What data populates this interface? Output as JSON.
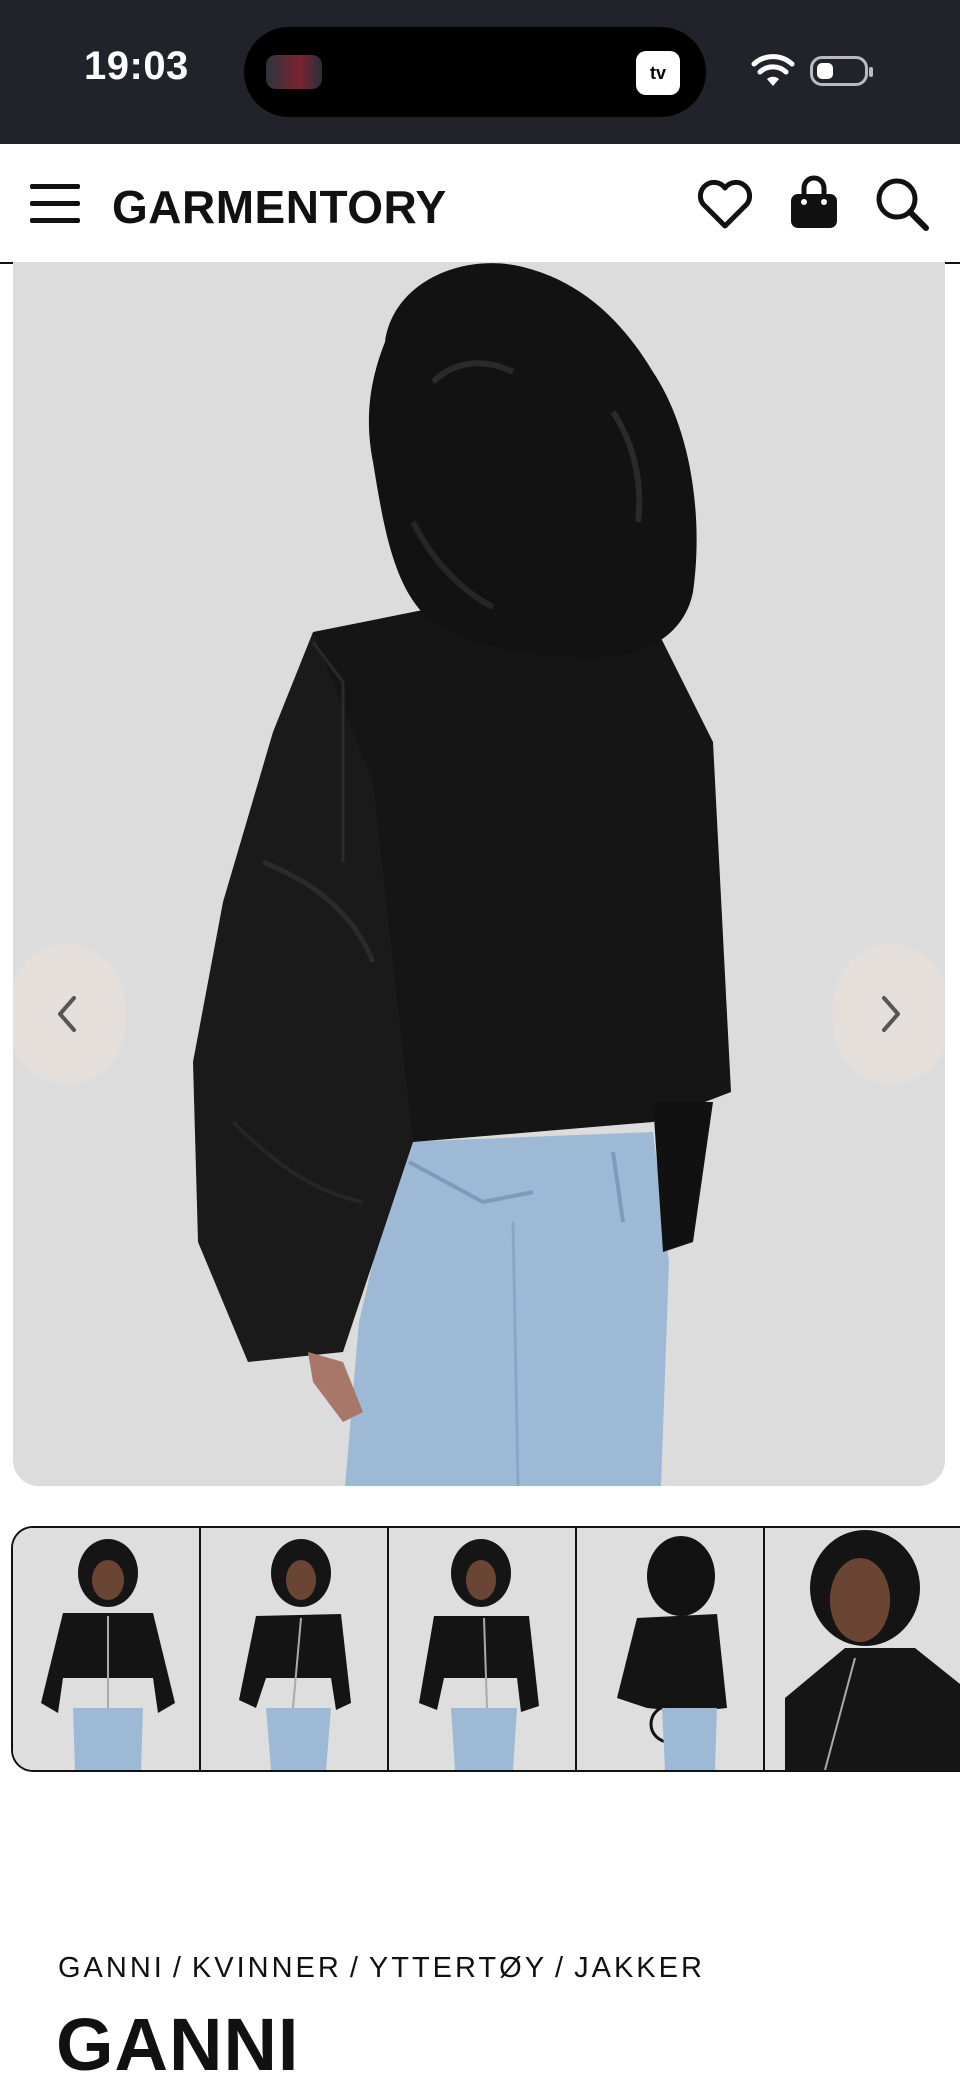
{
  "status_bar": {
    "time": "19:03",
    "island_icon": "apple-tv-icon",
    "island_label": "tv"
  },
  "header": {
    "logo": "GARMENTORY",
    "icons": [
      "menu-icon",
      "heart-icon",
      "bag-icon",
      "search-icon"
    ]
  },
  "gallery": {
    "main_image_alt": "black-bomber-jacket-back-view",
    "thumbnail_count": 5
  },
  "product": {
    "breadcrumb": [
      "GANNI",
      "KVINNER",
      "YTTERTØY",
      "JAKKER"
    ],
    "breadcrumb_separator": "/",
    "brand": "GANNI"
  },
  "colors": {
    "status_bar_bg": "#22232a",
    "image_bg": "#dcdcdc",
    "jacket": "#141414",
    "denim": "#9eb9d6"
  }
}
